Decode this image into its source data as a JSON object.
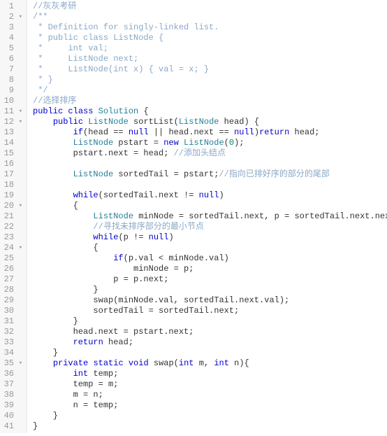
{
  "lines": [
    {
      "n": 1,
      "fold": false,
      "seg": [
        [
          "cm",
          "//灰灰考研"
        ]
      ]
    },
    {
      "n": 2,
      "fold": true,
      "seg": [
        [
          "cm",
          "/**"
        ]
      ]
    },
    {
      "n": 3,
      "fold": false,
      "seg": [
        [
          "cm",
          " * Definition for singly-linked list."
        ]
      ]
    },
    {
      "n": 4,
      "fold": false,
      "seg": [
        [
          "cm",
          " * public class ListNode {"
        ]
      ]
    },
    {
      "n": 5,
      "fold": false,
      "seg": [
        [
          "cm",
          " *     int val;"
        ]
      ]
    },
    {
      "n": 6,
      "fold": false,
      "seg": [
        [
          "cm",
          " *     ListNode next;"
        ]
      ]
    },
    {
      "n": 7,
      "fold": false,
      "seg": [
        [
          "cm",
          " *     ListNode(int x) { val = x; }"
        ]
      ]
    },
    {
      "n": 8,
      "fold": false,
      "seg": [
        [
          "cm",
          " * }"
        ]
      ]
    },
    {
      "n": 9,
      "fold": false,
      "seg": [
        [
          "cm",
          " */"
        ]
      ]
    },
    {
      "n": 10,
      "fold": false,
      "seg": [
        [
          "cm",
          "//选择排序"
        ]
      ]
    },
    {
      "n": 11,
      "fold": true,
      "seg": [
        [
          "kw",
          "public"
        ],
        [
          "nm",
          " "
        ],
        [
          "kw",
          "class"
        ],
        [
          "nm",
          " "
        ],
        [
          "ty",
          "Solution"
        ],
        [
          "nm",
          " {"
        ]
      ]
    },
    {
      "n": 12,
      "fold": true,
      "seg": [
        [
          "nm",
          "    "
        ],
        [
          "kw",
          "public"
        ],
        [
          "nm",
          " "
        ],
        [
          "ty",
          "ListNode"
        ],
        [
          "nm",
          " sortList("
        ],
        [
          "ty",
          "ListNode"
        ],
        [
          "nm",
          " head) {"
        ]
      ]
    },
    {
      "n": 13,
      "fold": false,
      "seg": [
        [
          "nm",
          "        "
        ],
        [
          "kw",
          "if"
        ],
        [
          "nm",
          "(head == "
        ],
        [
          "kw",
          "null"
        ],
        [
          "nm",
          " || head.next == "
        ],
        [
          "kw",
          "null"
        ],
        [
          "nm",
          ")"
        ],
        [
          "kw",
          "return"
        ],
        [
          "nm",
          " head;"
        ]
      ]
    },
    {
      "n": 14,
      "fold": false,
      "seg": [
        [
          "nm",
          "        "
        ],
        [
          "ty",
          "ListNode"
        ],
        [
          "nm",
          " pstart = "
        ],
        [
          "kw",
          "new"
        ],
        [
          "nm",
          " "
        ],
        [
          "ty",
          "ListNode"
        ],
        [
          "nm",
          "("
        ],
        [
          "nu",
          "0"
        ],
        [
          "nm",
          ");"
        ]
      ]
    },
    {
      "n": 15,
      "fold": false,
      "seg": [
        [
          "nm",
          "        pstart.next = head; "
        ],
        [
          "cm",
          "//添加头结点"
        ]
      ]
    },
    {
      "n": 16,
      "fold": false,
      "seg": [
        [
          "nm",
          ""
        ]
      ]
    },
    {
      "n": 17,
      "fold": false,
      "seg": [
        [
          "nm",
          "        "
        ],
        [
          "ty",
          "ListNode"
        ],
        [
          "nm",
          " sortedTail = pstart;"
        ],
        [
          "cm",
          "//指向已排好序的部分的尾部"
        ]
      ]
    },
    {
      "n": 18,
      "fold": false,
      "seg": [
        [
          "nm",
          ""
        ]
      ]
    },
    {
      "n": 19,
      "fold": false,
      "seg": [
        [
          "nm",
          "        "
        ],
        [
          "kw",
          "while"
        ],
        [
          "nm",
          "(sortedTail.next != "
        ],
        [
          "kw",
          "null"
        ],
        [
          "nm",
          ")"
        ]
      ]
    },
    {
      "n": 20,
      "fold": true,
      "seg": [
        [
          "nm",
          "        {"
        ]
      ]
    },
    {
      "n": 21,
      "fold": false,
      "seg": [
        [
          "nm",
          "            "
        ],
        [
          "ty",
          "ListNode"
        ],
        [
          "nm",
          " minNode = sortedTail.next, p = sortedTail.next.next;"
        ]
      ]
    },
    {
      "n": 22,
      "fold": false,
      "seg": [
        [
          "nm",
          "            "
        ],
        [
          "cm",
          "//寻找未排序部分的最小节点"
        ]
      ]
    },
    {
      "n": 23,
      "fold": false,
      "seg": [
        [
          "nm",
          "            "
        ],
        [
          "kw",
          "while"
        ],
        [
          "nm",
          "(p != "
        ],
        [
          "kw",
          "null"
        ],
        [
          "nm",
          ")"
        ]
      ]
    },
    {
      "n": 24,
      "fold": true,
      "seg": [
        [
          "nm",
          "            {"
        ]
      ]
    },
    {
      "n": 25,
      "fold": false,
      "seg": [
        [
          "nm",
          "                "
        ],
        [
          "kw",
          "if"
        ],
        [
          "nm",
          "(p.val < minNode.val)"
        ]
      ]
    },
    {
      "n": 26,
      "fold": false,
      "seg": [
        [
          "nm",
          "                    minNode = p;"
        ]
      ]
    },
    {
      "n": 27,
      "fold": false,
      "seg": [
        [
          "nm",
          "                p = p.next;"
        ]
      ]
    },
    {
      "n": 28,
      "fold": false,
      "seg": [
        [
          "nm",
          "            }"
        ]
      ]
    },
    {
      "n": 29,
      "fold": false,
      "seg": [
        [
          "nm",
          "            swap(minNode.val, sortedTail.next.val);"
        ]
      ]
    },
    {
      "n": 30,
      "fold": false,
      "seg": [
        [
          "nm",
          "            sortedTail = sortedTail.next;"
        ]
      ]
    },
    {
      "n": 31,
      "fold": false,
      "seg": [
        [
          "nm",
          "        }"
        ]
      ]
    },
    {
      "n": 32,
      "fold": false,
      "seg": [
        [
          "nm",
          "        head.next = pstart.next;"
        ]
      ]
    },
    {
      "n": 33,
      "fold": false,
      "seg": [
        [
          "nm",
          "        "
        ],
        [
          "kw",
          "return"
        ],
        [
          "nm",
          " head;"
        ]
      ]
    },
    {
      "n": 34,
      "fold": false,
      "seg": [
        [
          "nm",
          "    }"
        ]
      ]
    },
    {
      "n": 35,
      "fold": true,
      "seg": [
        [
          "nm",
          "    "
        ],
        [
          "kw",
          "private"
        ],
        [
          "nm",
          " "
        ],
        [
          "kw",
          "static"
        ],
        [
          "nm",
          " "
        ],
        [
          "kw",
          "void"
        ],
        [
          "nm",
          " swap("
        ],
        [
          "kw",
          "int"
        ],
        [
          "nm",
          " m, "
        ],
        [
          "kw",
          "int"
        ],
        [
          "nm",
          " n){"
        ]
      ]
    },
    {
      "n": 36,
      "fold": false,
      "seg": [
        [
          "nm",
          "        "
        ],
        [
          "kw",
          "int"
        ],
        [
          "nm",
          " temp;"
        ]
      ]
    },
    {
      "n": 37,
      "fold": false,
      "seg": [
        [
          "nm",
          "        temp = m;"
        ]
      ]
    },
    {
      "n": 38,
      "fold": false,
      "seg": [
        [
          "nm",
          "        m = n;"
        ]
      ]
    },
    {
      "n": 39,
      "fold": false,
      "seg": [
        [
          "nm",
          "        n = temp;"
        ]
      ]
    },
    {
      "n": 40,
      "fold": false,
      "seg": [
        [
          "nm",
          "    }"
        ]
      ]
    },
    {
      "n": 41,
      "fold": false,
      "seg": [
        [
          "nm",
          "}"
        ]
      ]
    }
  ]
}
